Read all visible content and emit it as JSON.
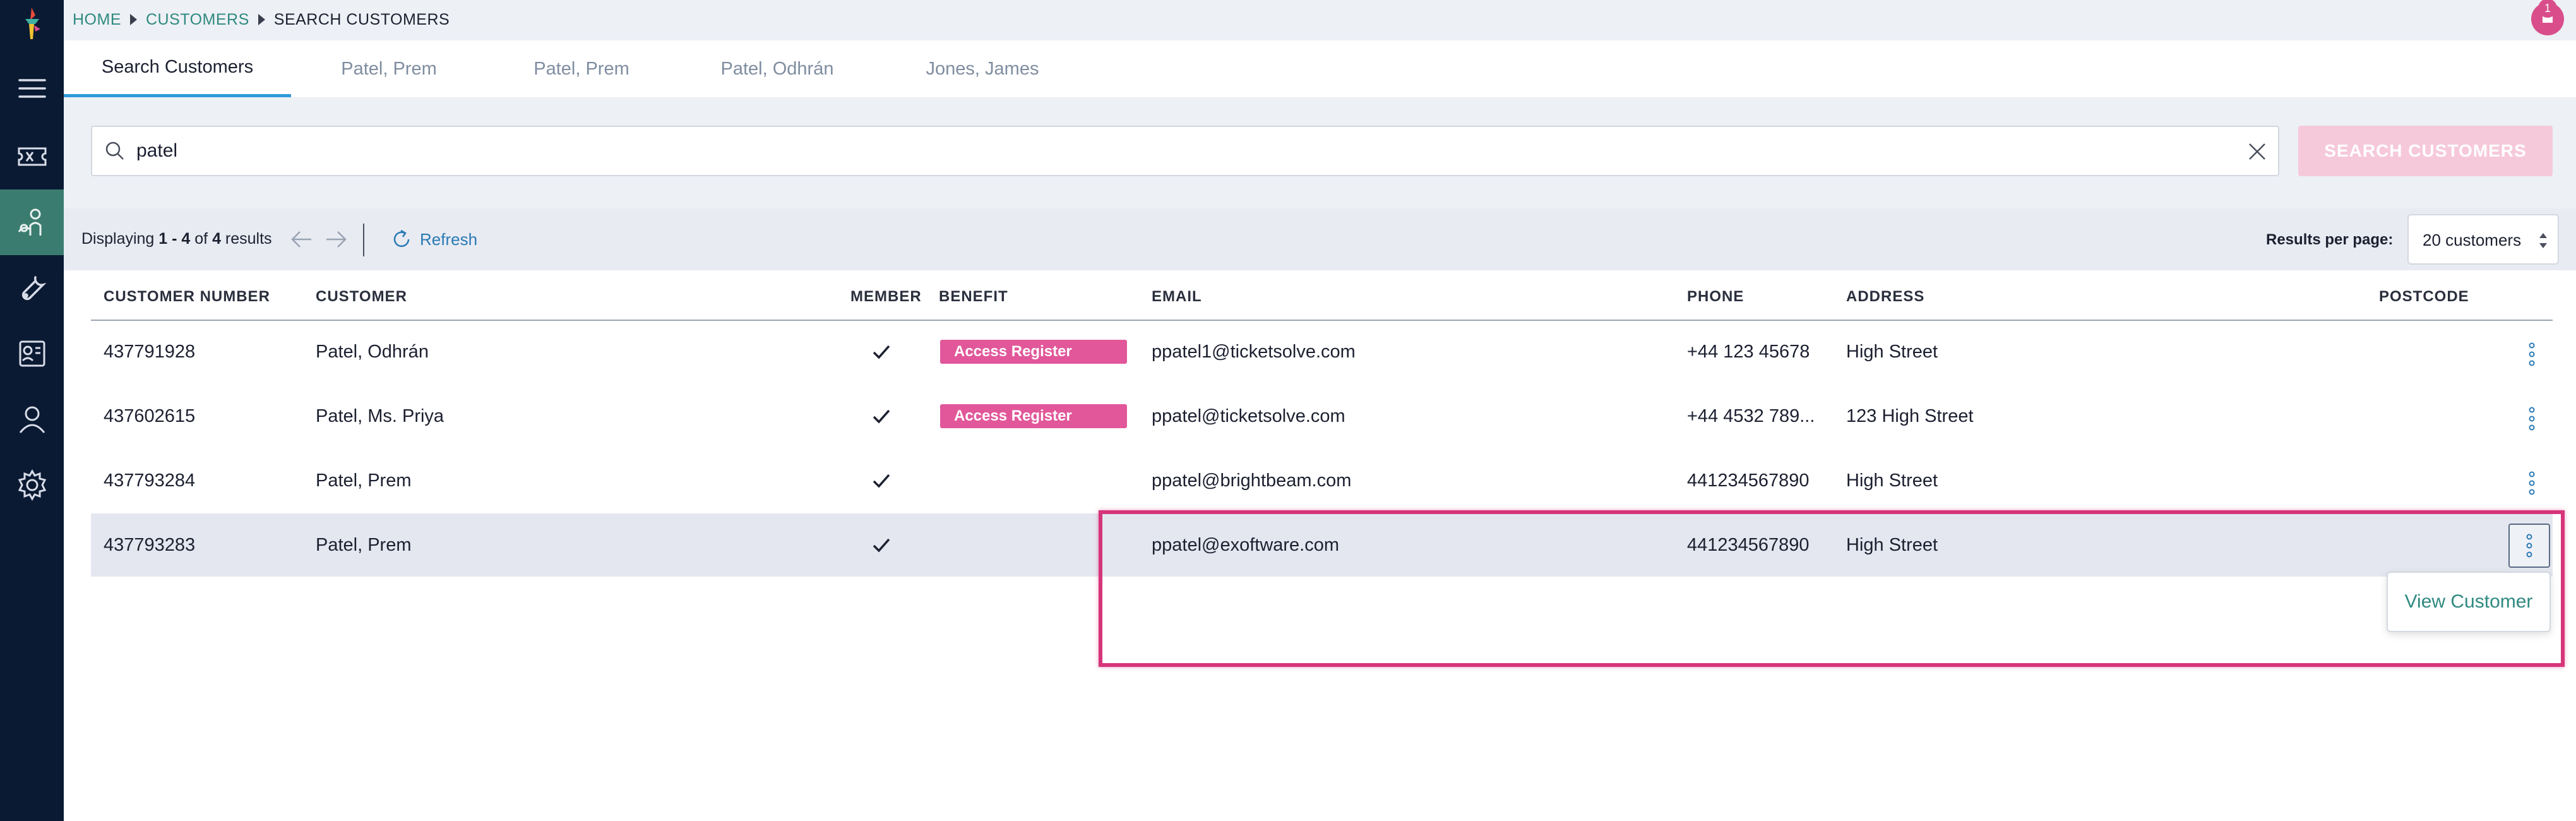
{
  "breadcrumb": {
    "home": "HOME",
    "customers": "CUSTOMERS",
    "current": "SEARCH CUSTOMERS"
  },
  "notifications": {
    "count": "1"
  },
  "tabs": [
    {
      "label": "Search Customers",
      "active": true
    },
    {
      "label": "Patel, Prem"
    },
    {
      "label": "Patel, Prem"
    },
    {
      "label": "Patel, Odhrán"
    },
    {
      "label": "Jones, James"
    }
  ],
  "search": {
    "value": "patel",
    "button_label": "SEARCH CUSTOMERS"
  },
  "results": {
    "display_prefix": "Displaying ",
    "range": "1 - 4",
    "of": " of ",
    "total": "4",
    "suffix": " results",
    "refresh_label": "Refresh",
    "per_page_label": "Results per page:",
    "per_page_value": "20 customers"
  },
  "table": {
    "headers": {
      "customer_number": "CUSTOMER NUMBER",
      "customer": "CUSTOMER",
      "member": "MEMBER",
      "benefit": "BENEFIT",
      "email": "EMAIL",
      "phone": "PHONE",
      "address": "ADDRESS",
      "postcode": "POSTCODE"
    },
    "rows": [
      {
        "number": "437791928",
        "customer": "Patel, Odhrán",
        "member": true,
        "benefit": "Access Register",
        "email": "ppatel1@ticketsolve.com",
        "phone": "+44 123 45678",
        "address": "High Street",
        "postcode": ""
      },
      {
        "number": "437602615",
        "customer": "Patel, Ms. Priya",
        "member": true,
        "benefit": "Access Register",
        "email": "ppatel@ticketsolve.com",
        "phone": "+44 4532 789...",
        "address": "123 High Street",
        "postcode": ""
      },
      {
        "number": "437793284",
        "customer": "Patel, Prem",
        "member": true,
        "benefit": "",
        "email": "ppatel@brightbeam.com",
        "phone": "441234567890",
        "address": "High Street",
        "postcode": ""
      },
      {
        "number": "437793283",
        "customer": "Patel, Prem",
        "member": true,
        "benefit": "",
        "email": "ppatel@exoftware.com",
        "phone": "441234567890",
        "address": "High Street",
        "postcode": ""
      }
    ]
  },
  "row_menu": {
    "view_customer": "View Customer"
  },
  "colors": {
    "sidebar": "#0b1a33",
    "sidebar_active": "#3b7c70",
    "accent_link": "#2f8a80",
    "tab_underline": "#2d9ad9",
    "badge": "#e1579a",
    "highlight_border": "#d6357a"
  }
}
